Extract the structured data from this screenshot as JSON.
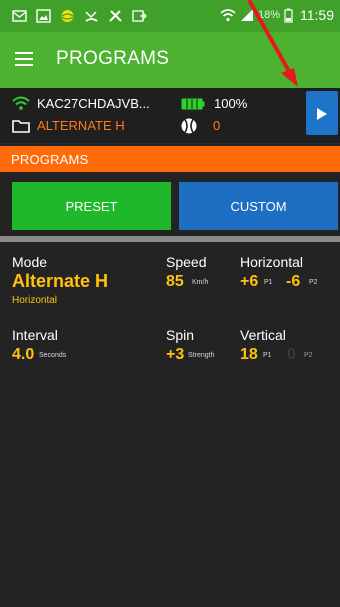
{
  "status_bar": {
    "battery_percent": "18%",
    "time": "11:59",
    "icons": [
      "mail-icon",
      "image-icon",
      "app-icon",
      "missed-call-icon",
      "tools-icon",
      "sync-icon",
      "wifi-icon",
      "signal-icon",
      "battery-icon"
    ]
  },
  "app_bar": {
    "title": "PROGRAMS",
    "menu_icon": "hamburger-icon"
  },
  "device": {
    "name": "KAC27CHDAJVB...",
    "battery": "100%",
    "mode": "ALTERNATE H",
    "ball_count": "0"
  },
  "section": {
    "title": "PROGRAMS"
  },
  "buttons": {
    "preset": "PRESET",
    "custom": "CUSTOM"
  },
  "params": {
    "mode": {
      "label": "Mode",
      "value": "Alternate H",
      "sub": "Horizontal"
    },
    "speed": {
      "label": "Speed",
      "value": "85",
      "unit": "Km/h"
    },
    "horizontal": {
      "label": "Horizontal",
      "p1_value": "+6",
      "p1_label": "P1",
      "p2_value": "-6",
      "p2_label": "P2"
    },
    "interval": {
      "label": "Interval",
      "value": "4.0",
      "unit": "Seconds"
    },
    "spin": {
      "label": "Spin",
      "value": "+3",
      "unit": "Strength"
    },
    "vertical": {
      "label": "Vertical",
      "p1_value": "18",
      "p1_label": "P1",
      "p2_value": "0",
      "p2_label": "P2"
    }
  },
  "colors": {
    "status_bar": "#3fa12a",
    "app_bar": "#4cb230",
    "accent_orange": "#ff6a0b",
    "value_yellow": "#ffc20e",
    "preset_green": "#1eb82a",
    "custom_blue": "#1e6fc3",
    "annotation_red": "#e51b1b"
  }
}
